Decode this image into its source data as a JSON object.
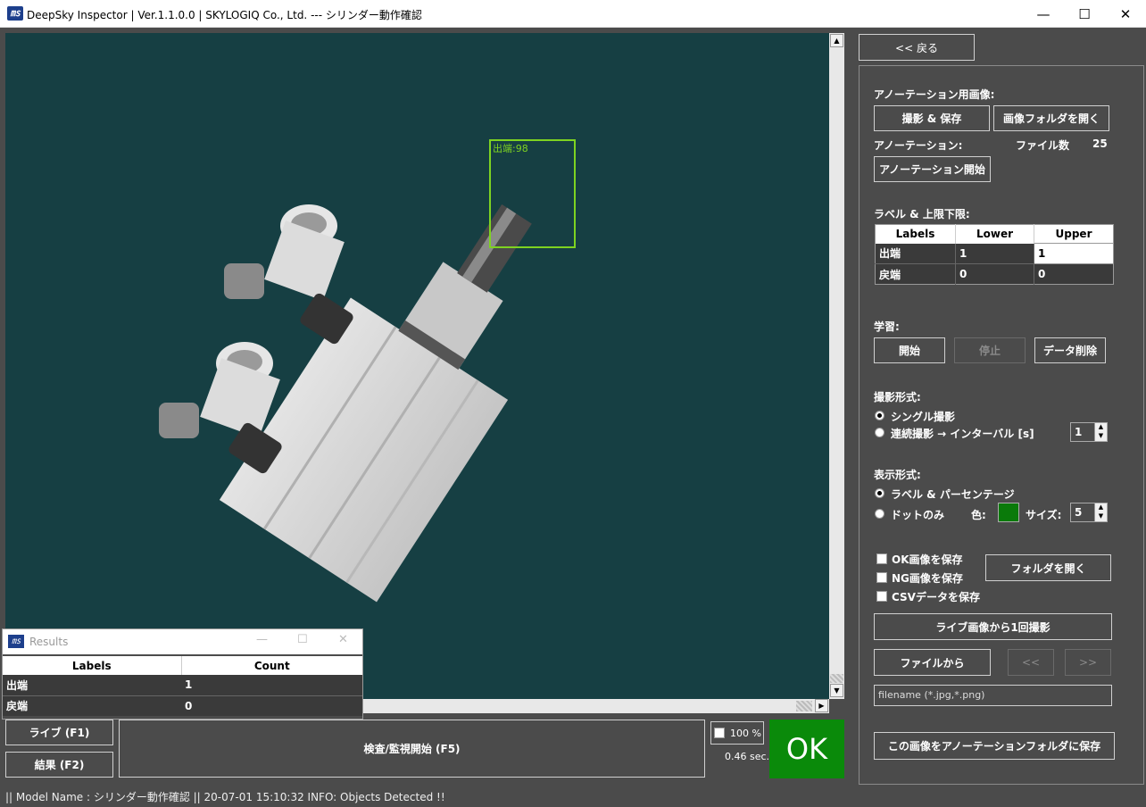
{
  "window": {
    "title": "DeepSky Inspector | Ver.1.1.0.0 | SKYLOGIQ Co., Ltd. --- シリンダー動作確認",
    "minimize_glyph": "—",
    "maximize_glyph": "☐",
    "close_glyph": "✕"
  },
  "viewport": {
    "detection_label": "出端:98",
    "detection_color": "#7ed321",
    "background_color": "#163f43"
  },
  "annotation_panel": {
    "back_button": "<< 戻る",
    "annotation_image_heading": "アノーテーション用画像:",
    "capture_save_button": "撮影 & 保存",
    "open_image_folder_button": "画像フォルダを開く",
    "annotation_heading": "アノーテーション:",
    "file_count_label": "ファイル数",
    "file_count_value": "25",
    "start_annotation_button": "アノーテーション開始",
    "label_limits_heading": "ラベル & 上限下限:",
    "label_table": {
      "headers": [
        "Labels",
        "Lower",
        "Upper"
      ],
      "rows": [
        {
          "label": "出端",
          "lower": "1",
          "upper": "1"
        },
        {
          "label": "戻端",
          "lower": "0",
          "upper": "0"
        }
      ]
    },
    "learning_heading": "学習:",
    "learn_start_button": "開始",
    "learn_stop_button": "停止",
    "delete_data_button": "データ削除",
    "capture_mode_heading": "撮影形式:",
    "single_capture_option": "シングル撮影",
    "continuous_capture_option": "連続撮影 → インターバル [s]",
    "interval_value": "1",
    "display_mode_heading": "表示形式:",
    "label_percentage_option": "ラベル & パーセンテージ",
    "dot_only_option": "ドットのみ",
    "color_label": "色:",
    "dot_color": "#0a7a0a",
    "size_label": "サイズ:",
    "size_value": "5",
    "save_ok_images": "OK画像を保存",
    "save_ng_images": "NG画像を保存",
    "save_csv": "CSVデータを保存",
    "open_folder_button": "フォルダを開く",
    "capture_once_button": "ライブ画像から1回撮影",
    "from_file_button": "ファイルから",
    "prev_button": "<<",
    "next_button": ">>",
    "filename_placeholder": "filename (*.jpg,*.png)",
    "save_to_annotation_button": "この画像をアノーテーションフォルダに保存"
  },
  "results_window": {
    "title": "Results",
    "headers": [
      "Labels",
      "Count"
    ],
    "rows": [
      {
        "label": "出端",
        "count": "1"
      },
      {
        "label": "戻端",
        "count": "0"
      }
    ]
  },
  "bottom": {
    "live_button": "ライブ (F1)",
    "result_button": "結果 (F2)",
    "inspect_button": "検査/監視開始 (F5)",
    "zoom_checkbox_label": "100 %",
    "elapsed": "0.46 sec.",
    "judgement": "OK",
    "judgement_color": "#0a8a0a"
  },
  "status_bar": {
    "text": "|| Model Name : シリンダー動作確認 ||    20-07-01 15:10:32   INFO:   Objects Detected !!"
  }
}
